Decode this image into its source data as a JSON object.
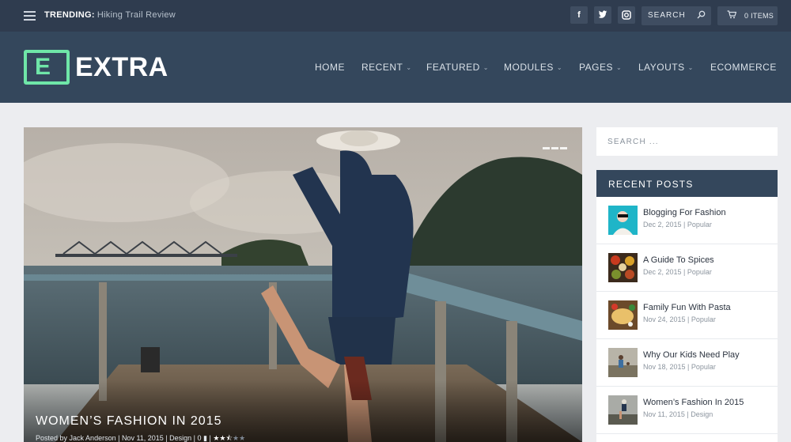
{
  "topbar": {
    "trending_label": "TRENDING:",
    "trending_title": "Hiking Trail Review",
    "social": [
      "f",
      "t",
      "ig"
    ],
    "search_label": "SEARCH",
    "cart_label": "0 ITEMS"
  },
  "header": {
    "logo_letter": "E",
    "logo_text": "EXTRA",
    "nav": [
      {
        "label": "HOME",
        "has_dropdown": false
      },
      {
        "label": "RECENT",
        "has_dropdown": true
      },
      {
        "label": "FEATURED",
        "has_dropdown": true
      },
      {
        "label": "MODULES",
        "has_dropdown": true
      },
      {
        "label": "PAGES",
        "has_dropdown": true
      },
      {
        "label": "LAYOUTS",
        "has_dropdown": true
      },
      {
        "label": "ECOMMERCE",
        "has_dropdown": false
      }
    ]
  },
  "hero": {
    "title": "WOMEN’S FASHION IN 2015",
    "posted_by": "Posted by",
    "author": "Jack Anderson",
    "date": "Nov 11, 2015",
    "category": "Design",
    "comments": "0",
    "rating": 2.5
  },
  "sidebar": {
    "search_placeholder": "SEARCH ...",
    "recent_title": "RECENT POSTS",
    "posts": [
      {
        "title": "Blogging For Fashion",
        "date": "Dec 2, 2015",
        "category": "Popular"
      },
      {
        "title": "A Guide To Spices",
        "date": "Dec 2, 2015",
        "category": "Popular"
      },
      {
        "title": "Family Fun With Pasta",
        "date": "Nov 24, 2015",
        "category": "Popular"
      },
      {
        "title": "Why Our Kids Need Play",
        "date": "Nov 18, 2015",
        "category": "Popular"
      },
      {
        "title": "Women’s Fashion In 2015",
        "date": "Nov 11, 2015",
        "category": "Design"
      }
    ]
  },
  "colors": {
    "topbar": "#2f3c4f",
    "header": "#34475c",
    "accent_green": "#6fe6a8",
    "background": "#ecedf0"
  },
  "icons": {
    "menu": "hamburger-icon",
    "search": "search-icon",
    "cart": "cart-icon",
    "comment": "comment-icon",
    "star": "star-icon"
  }
}
